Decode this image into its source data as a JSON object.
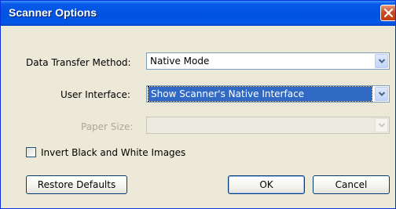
{
  "window": {
    "title": "Scanner Options"
  },
  "fields": {
    "transfer": {
      "label": "Data Transfer Method:",
      "value": "Native Mode"
    },
    "ui": {
      "label": "User Interface:",
      "value": "Show Scanner's Native Interface"
    },
    "paper": {
      "label": "Paper Size:",
      "value": ""
    }
  },
  "checkbox": {
    "label": "Invert Black and White Images",
    "checked": false
  },
  "buttons": {
    "restore": "Restore Defaults",
    "ok": "OK",
    "cancel": "Cancel"
  }
}
